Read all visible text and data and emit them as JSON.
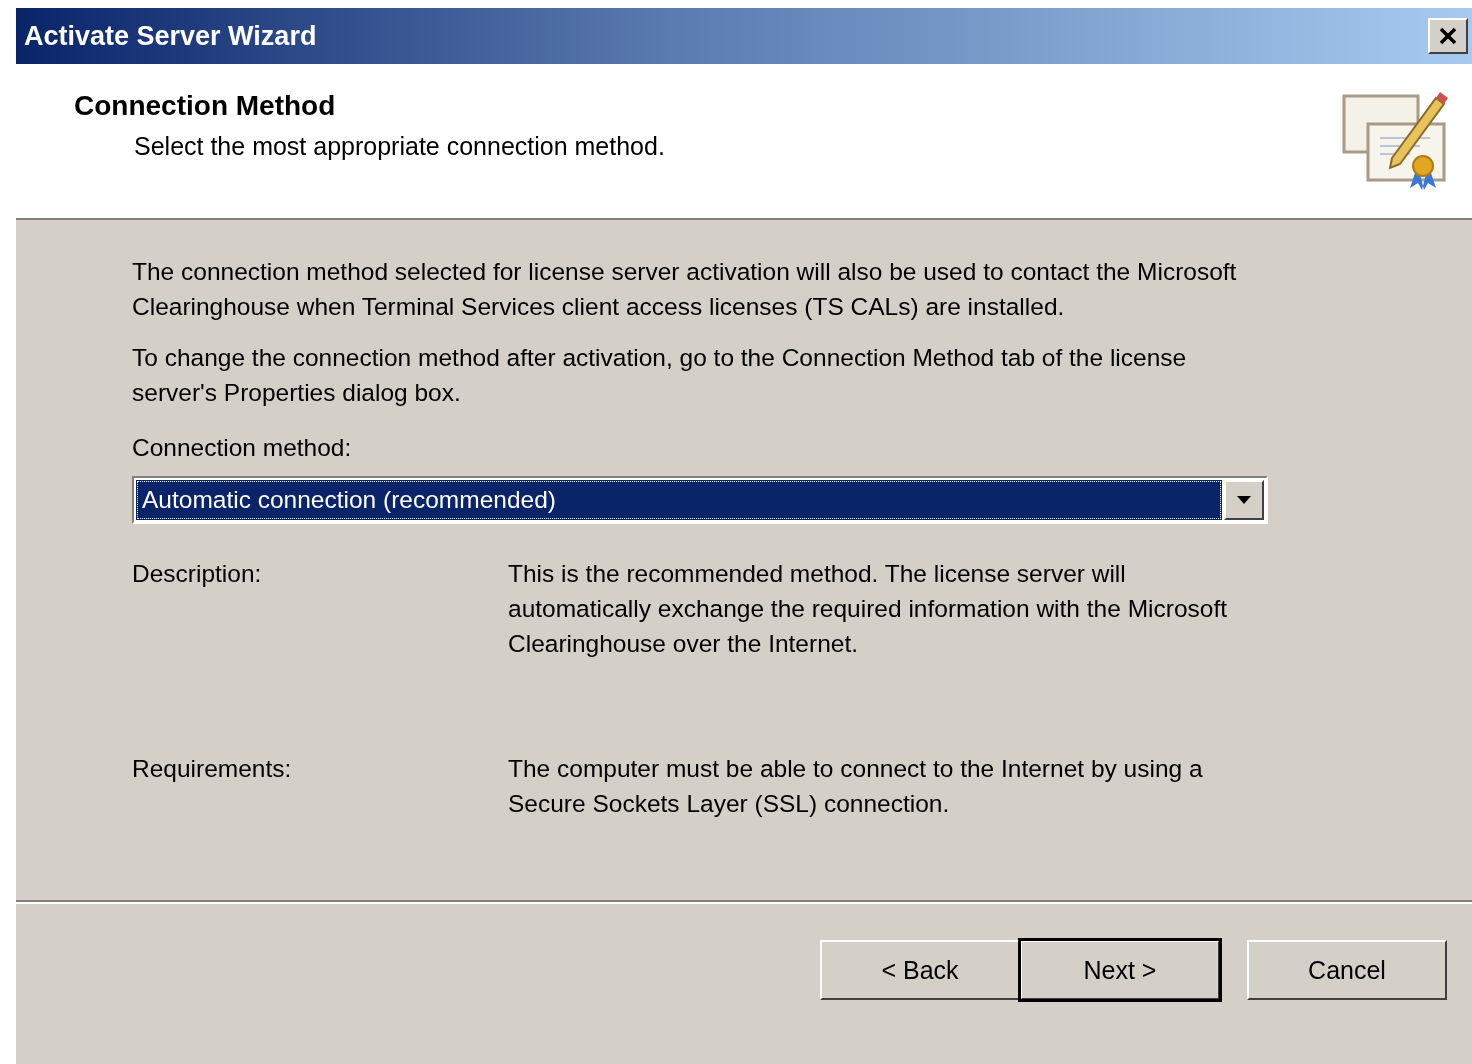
{
  "window": {
    "title": "Activate Server Wizard"
  },
  "header": {
    "title": "Connection Method",
    "subtitle": "Select the most appropriate connection method."
  },
  "paragraphs": [
    "The connection method selected for license server activation will also be used to contact the Microsoft Clearinghouse when Terminal Services client access licenses (TS CALs) are installed.",
    "To change the connection method after activation, go to the Connection Method tab of the license server's Properties dialog box."
  ],
  "connection_method": {
    "label": "Connection method:",
    "value": "Automatic connection (recommended)",
    "focused": true
  },
  "details": [
    {
      "label": "Description:",
      "text": "This is the recommended method. The license server will automatically exchange the required information with the Microsoft Clearinghouse over the Internet."
    },
    {
      "label": "Requirements:",
      "text": "The computer must be able to connect to the Internet by using a Secure Sockets Layer (SSL) connection."
    }
  ],
  "buttons": [
    {
      "label": "< Back",
      "default": false
    },
    {
      "label": "Next >",
      "default": true
    },
    {
      "label": "Cancel",
      "default": false
    }
  ]
}
